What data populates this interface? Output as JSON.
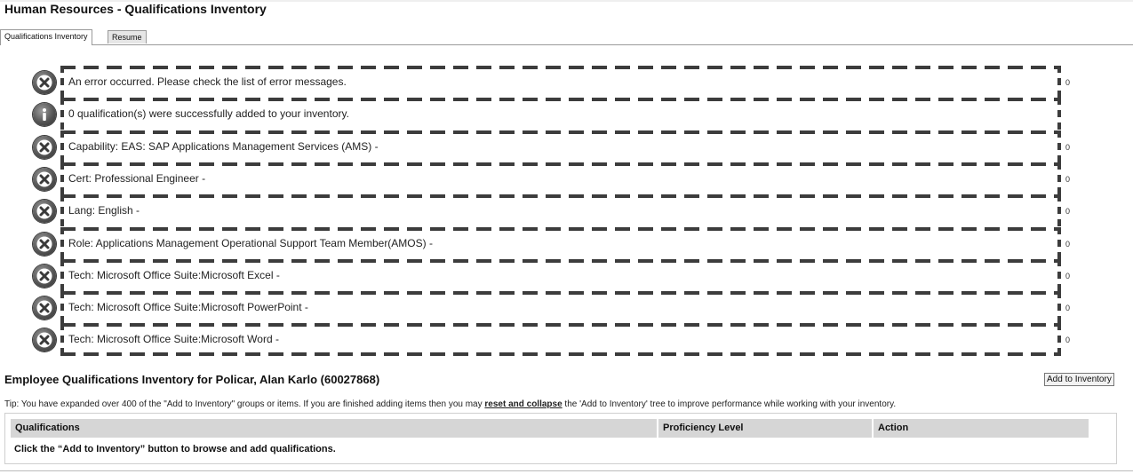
{
  "page": {
    "title": "Human Resources - Qualifications Inventory"
  },
  "tabs": [
    {
      "label": "Qualifications Inventory",
      "active": true
    },
    {
      "label": "Resume",
      "active": false
    }
  ],
  "messages": [
    {
      "icon": "error-icon",
      "text": "An error occurred. Please check the list of error messages.",
      "count": "0"
    },
    {
      "icon": "info-icon",
      "text": "0 qualification(s) were successfully added to your inventory.",
      "count": ""
    },
    {
      "icon": "error-icon",
      "text": "Capability: EAS: SAP Applications Management Services (AMS) -",
      "count": "0"
    },
    {
      "icon": "error-icon",
      "text": "Cert: Professional Engineer -",
      "count": "0"
    },
    {
      "icon": "error-icon",
      "text": "Lang: English -",
      "count": "0"
    },
    {
      "icon": "error-icon",
      "text": "Role: Applications Management Operational Support Team Member(AMOS) -",
      "count": "0"
    },
    {
      "icon": "error-icon",
      "text": "Tech: Microsoft Office Suite:Microsoft Excel -",
      "count": "0"
    },
    {
      "icon": "error-icon",
      "text": "Tech: Microsoft Office Suite:Microsoft PowerPoint -",
      "count": "0"
    },
    {
      "icon": "error-icon",
      "text": "Tech: Microsoft Office Suite:Microsoft Word -",
      "count": "0"
    }
  ],
  "inventory": {
    "title": "Employee Qualifications Inventory for Policar, Alan Karlo (60027868)",
    "add_button_label": "Add to Inventory",
    "tip_before": "Tip: You have expanded over 400 of the \"Add to Inventory\" groups or items. If you are finished adding items then you may ",
    "tip_link": "reset and collapse",
    "tip_after": " the 'Add to Inventory' tree to improve performance while working with your inventory.",
    "columns": [
      "Qualifications",
      "Proficiency Level",
      "Action"
    ],
    "empty_message": "Click the “Add to Inventory” button to browse and add qualifications."
  }
}
